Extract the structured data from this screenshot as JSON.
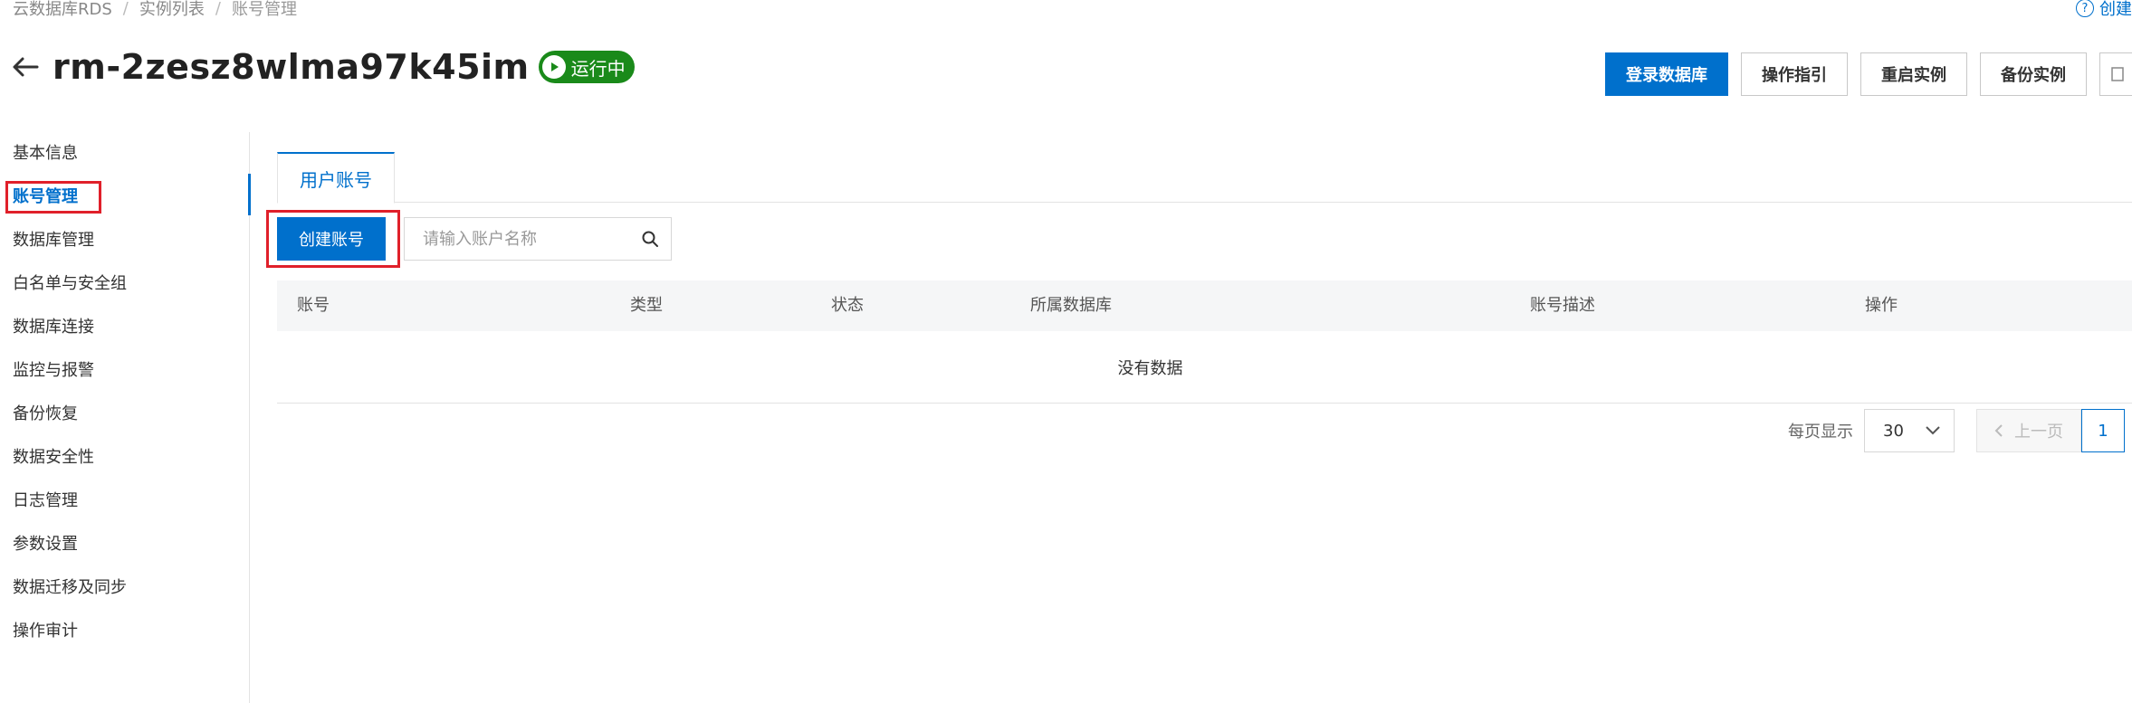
{
  "breadcrumb": [
    "云数据库RDS",
    "实例列表",
    "账号管理"
  ],
  "top_right_link": "创建",
  "instance": {
    "id": "rm-2zesz8wlma97k45im",
    "status": "运行中"
  },
  "header_actions": [
    "登录数据库",
    "操作指引",
    "重启实例",
    "备份实例"
  ],
  "sidebar": {
    "items": [
      "基本信息",
      "账号管理",
      "数据库管理",
      "白名单与安全组",
      "数据库连接",
      "监控与报警",
      "备份恢复",
      "数据安全性",
      "日志管理",
      "参数设置",
      "数据迁移及同步",
      "操作审计"
    ],
    "active_index": 1
  },
  "tabs": [
    "用户账号"
  ],
  "toolbar": {
    "create_label": "创建账号",
    "search_placeholder": "请输入账户名称"
  },
  "table": {
    "columns": [
      "账号",
      "类型",
      "状态",
      "所属数据库",
      "账号描述",
      "操作"
    ],
    "empty_text": "没有数据"
  },
  "pagination": {
    "per_page_label": "每页显示",
    "page_size": "30",
    "prev_label": "上一页",
    "current_page": "1"
  },
  "colors": {
    "primary": "#0070cc",
    "status_green": "#1a8a1a",
    "highlight_red": "#e0202a"
  }
}
